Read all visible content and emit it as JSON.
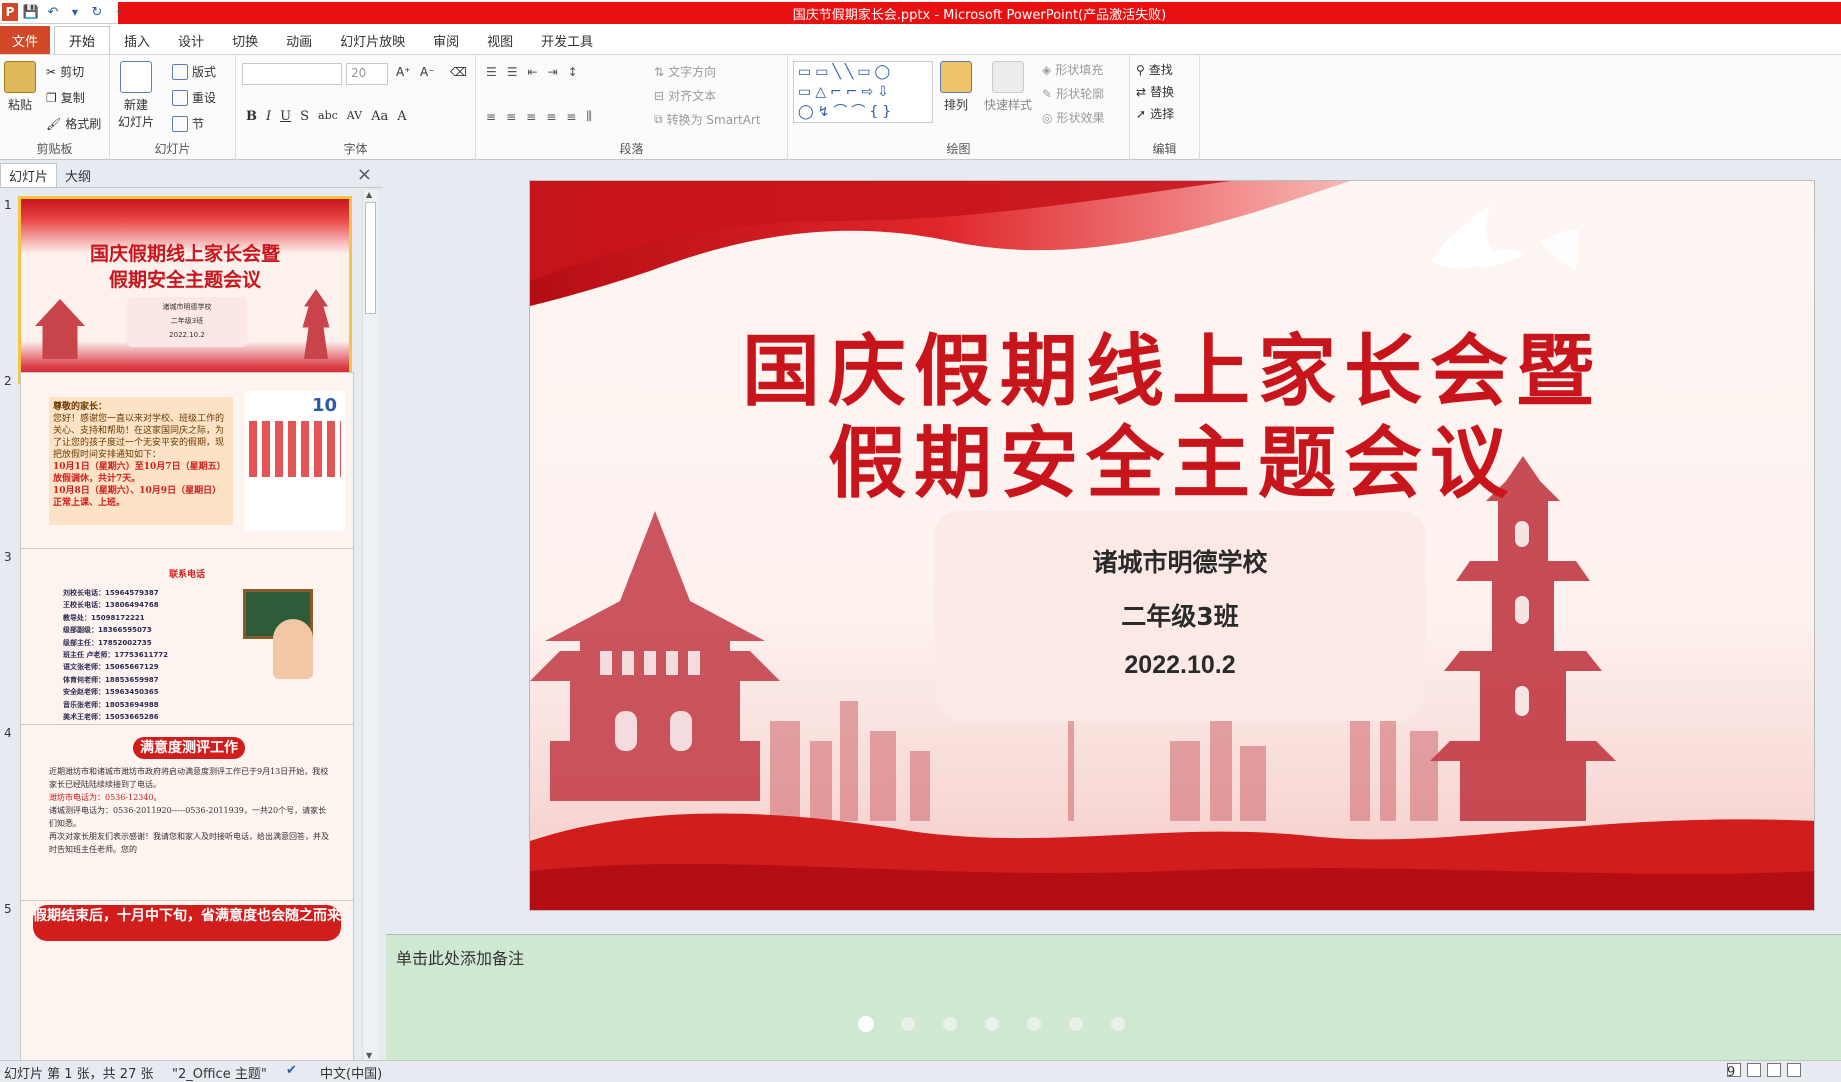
{
  "window": {
    "title": "国庆节假期家长会.pptx - Microsoft PowerPoint(产品激活失败)"
  },
  "quick_access": {
    "app_icon": "P",
    "save_icon": "save-icon",
    "undo_icon": "undo-icon",
    "redo_icon": "redo-icon"
  },
  "tabs": [
    "文件",
    "开始",
    "插入",
    "设计",
    "切换",
    "动画",
    "幻灯片放映",
    "审阅",
    "视图",
    "开发工具"
  ],
  "ribbon": {
    "clipboard": {
      "paste": "粘贴",
      "cut": "剪切",
      "copy": "复制",
      "format_painter": "格式刷",
      "label": "剪贴板"
    },
    "slides": {
      "new_slide_1": "新建",
      "new_slide_2": "幻灯片",
      "layout": "版式",
      "reset": "重设",
      "section": "节",
      "label": "幻灯片"
    },
    "font": {
      "size": "20",
      "bold": "B",
      "italic": "I",
      "underline": "U",
      "strike": "S",
      "shadow": "abc",
      "spacing": "AV",
      "case": "Aa",
      "color": "A",
      "grow": "A⁺",
      "shrink": "A⁻",
      "label": "字体"
    },
    "paragraph": {
      "text_direction": "文字方向",
      "align_text": "对齐文本",
      "smartart": "转换为 SmartArt",
      "label": "段落"
    },
    "drawing": {
      "arrange": "排列",
      "quick_styles": "快速样式",
      "shape_fill": "形状填充",
      "shape_outline": "形状轮廓",
      "shape_effects": "形状效果",
      "label": "绘图"
    },
    "editing": {
      "find": "查找",
      "replace": "替换",
      "select": "选择",
      "label": "编辑"
    }
  },
  "panel": {
    "tab_slides": "幻灯片",
    "tab_outline": "大纲",
    "close": "×"
  },
  "thumbnails": [
    {
      "num": "1",
      "title1": "国庆假期线上家长会暨",
      "title2": "假期安全主题会议",
      "l1": "诸城市明德学校",
      "l2": "二年级3班",
      "l3": "2022.10.2"
    },
    {
      "num": "2",
      "greeting": "尊敬的家长：",
      "body": "您好！感谢您一直以来对学校、班级工作的关心、支持和帮助！在这家国同庆之际，为了让您的孩子度过一个无安平安的假期，现把放假时间安排通知如下：",
      "red1": "10月1日（星期六）至10月7日（星期五）放假调休，共计7天。",
      "red2": "10月8日（星期六）、10月9日（星期日）正常上课、上班。",
      "cal": "10"
    },
    {
      "num": "3",
      "heading": "联系电话",
      "rows": [
        "刘校长电话：15964579387",
        "王校长电话：13806494768",
        "教导处：15098172221",
        "级部副级：18366595073",
        "级部主任：17852002735",
        "班主任 卢老师：17753611772",
        "语文张老师：15065667129",
        "体育何老师：18853659987",
        "安全赵老师：15963450365",
        "音乐张老师：18053694988",
        "美术王老师：15053665286"
      ]
    },
    {
      "num": "4",
      "heading": "满意度测评工作",
      "p1": "近期潍坊市和诸城市潍坊市政府将启动满意度测评工作已于9月13日开始，我校家长已经陆陆续续接到了电话。",
      "red": "潍坊市电话为：0536-12340。",
      "p2": "诸城测评电话为：0536-2011920-----0536-2011939，一共20个号，请家长们知悉。",
      "p3": "再次对家长朋友们表示感谢！我请您和家人及时接听电话，给出满意回答，并及时告知班主任老师。您的"
    },
    {
      "num": "5",
      "heading": "假期结束后，十月中下旬，省满意度也会随之而来"
    }
  ],
  "slide": {
    "title1": "国庆假期线上家长会暨",
    "title2": "假期安全主题会议",
    "school": "诸城市明德学校",
    "class": "二年级3班",
    "date": "2022.10.2"
  },
  "notes": {
    "placeholder": "单击此处添加备注"
  },
  "status": {
    "slide_info": "幻灯片 第 1 张，共 27 张",
    "theme": "\"2_Office 主题\"",
    "language": "中文(中国)",
    "zoom": "9"
  }
}
